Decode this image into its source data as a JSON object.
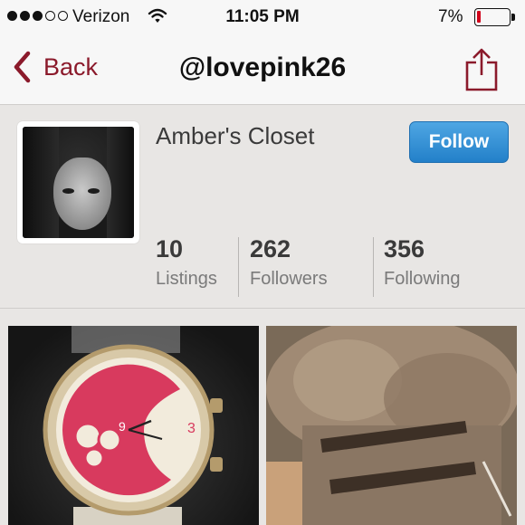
{
  "status_bar": {
    "carrier": "Verizon",
    "time": "11:05 PM",
    "battery_percent": "7%",
    "battery_level": 0.07,
    "signal_bars_filled": 3,
    "signal_bars_total": 5
  },
  "nav": {
    "back_label": "Back",
    "title": "@lovepink26",
    "share_icon": "share-icon"
  },
  "profile": {
    "closet_name": "Amber's Closet",
    "follow_label": "Follow",
    "stats": [
      {
        "value": "10",
        "label": "Listings"
      },
      {
        "value": "262",
        "label": "Followers"
      },
      {
        "value": "356",
        "label": "Following"
      }
    ]
  },
  "colors": {
    "accent": "#8b1a2b",
    "follow_button": "#2f8ad3",
    "battery_low": "#d0021b"
  }
}
